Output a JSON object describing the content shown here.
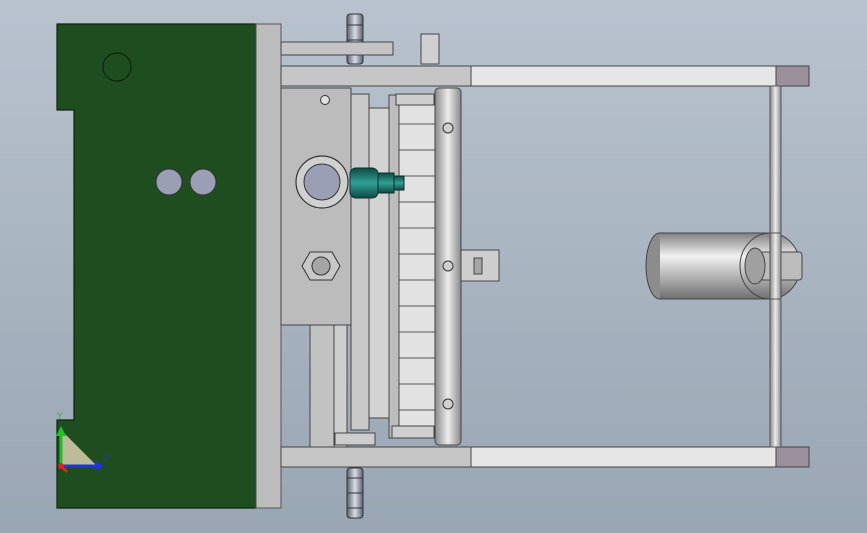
{
  "view": {
    "background_top": "#b8c3ce",
    "background_bottom": "#99a6b3"
  },
  "colors": {
    "plate_green": "#1e4d1f",
    "steel": "#b9b9b9",
    "steel_dark": "#8f8f8f",
    "steel_light": "#d8d8d8",
    "rail_light": "#e6e6e6",
    "end_block": "#9a8f9a",
    "nozzle_teal": "#1d6f66",
    "hole_fill": "#9b9fb5"
  },
  "triad": {
    "y_label": "Y",
    "z_label": "Z",
    "y_color": "#21c021",
    "z_color": "#2233dd",
    "x_color": "#dd2222"
  }
}
